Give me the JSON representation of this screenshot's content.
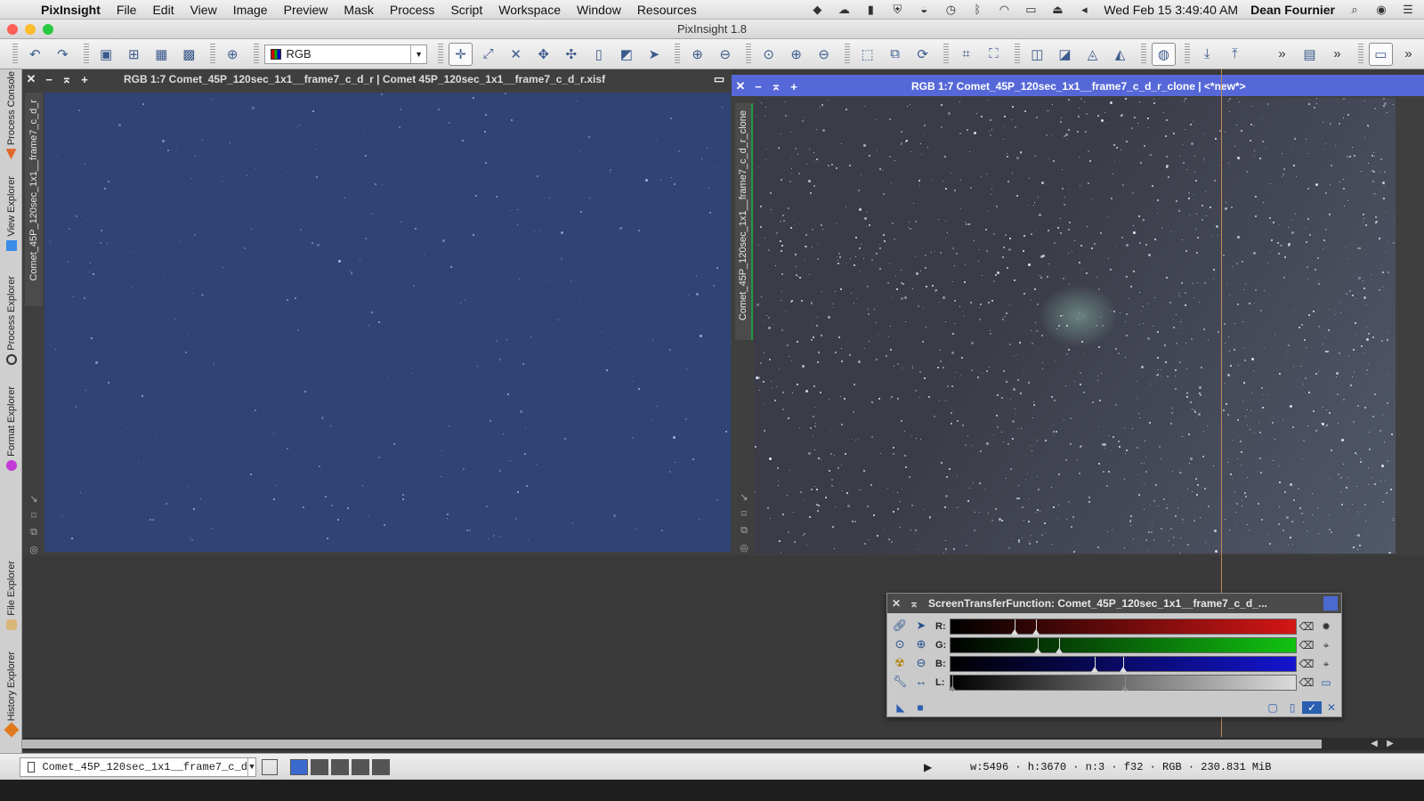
{
  "menubar": {
    "app_name": "PixInsight",
    "items": [
      "File",
      "Edit",
      "View",
      "Image",
      "Preview",
      "Mask",
      "Process",
      "Script",
      "Workspace",
      "Window",
      "Resources"
    ],
    "clock": "Wed Feb 15  3:49:40 AM",
    "user": "Dean Fournier"
  },
  "window": {
    "title": "PixInsight 1.8"
  },
  "toolbar": {
    "color_space_value": "RGB"
  },
  "left_tabs": [
    "Process Console",
    "View Explorer",
    "Process Explorer",
    "Format Explorer",
    "File Explorer",
    "History Explorer"
  ],
  "image_window_1": {
    "title": "RGB 1:7 Comet_45P_120sec_1x1__frame7_c_d_r | Comet 45P_120sec_1x1__frame7_c_d_r.xisf",
    "view_tab": "Comet_45P_120sec_1x1__frame7_c_d_r"
  },
  "image_window_2": {
    "title": "RGB 1:7 Comet_45P_120sec_1x1__frame7_c_d_r_clone | <*new*>",
    "view_tab": "Comet_45P_120sec_1x1__frame7_c_d_r_clone"
  },
  "stf": {
    "title": "ScreenTransferFunction: Comet_45P_120sec_1x1__frame7_c_d_...",
    "channels": [
      {
        "label": "R:",
        "color": "#d51616"
      },
      {
        "label": "G:",
        "color": "#11c311"
      },
      {
        "label": "B:",
        "color": "#1414d0"
      },
      {
        "label": "L:",
        "color": "#dcdcdc"
      }
    ]
  },
  "statusbar": {
    "view_selector": "Comet_45P_120sec_1x1__frame7_c_d",
    "info": "w:5496 · h:3670 · n:3 · f32 · RGB · 230.831 MiB"
  },
  "colors": {
    "accent": "#5668d8",
    "image1_bg": "#2f4475",
    "image2_bg": "#3b3c47"
  }
}
